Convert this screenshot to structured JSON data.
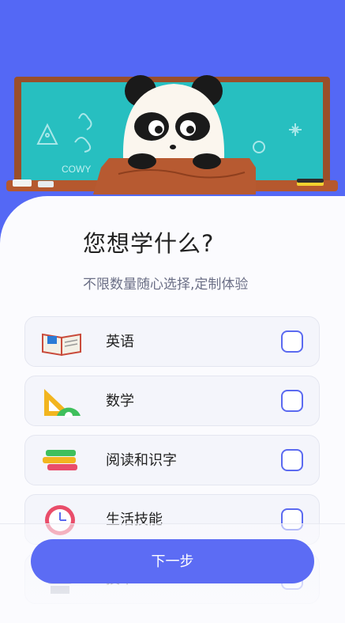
{
  "colors": {
    "accent": "#5c6cf4",
    "background_top": "#5468f5",
    "checkbox_border": "#5b6af0"
  },
  "header": {
    "title": "您想学什么?",
    "subtitle": "不限数量随心选择,定制体验",
    "chalk_text": "COWY"
  },
  "options": [
    {
      "label": "英语",
      "icon": "book-icon",
      "checked": false
    },
    {
      "label": "数学",
      "icon": "ruler-triangle-icon",
      "checked": false
    },
    {
      "label": "阅读和识字",
      "icon": "stacked-books-icon",
      "checked": false
    },
    {
      "label": "生活技能",
      "icon": "clock-icon",
      "checked": false
    },
    {
      "label": "技术",
      "icon": "robot-icon",
      "checked": false
    }
  ],
  "footer": {
    "next_label": "下一步"
  }
}
